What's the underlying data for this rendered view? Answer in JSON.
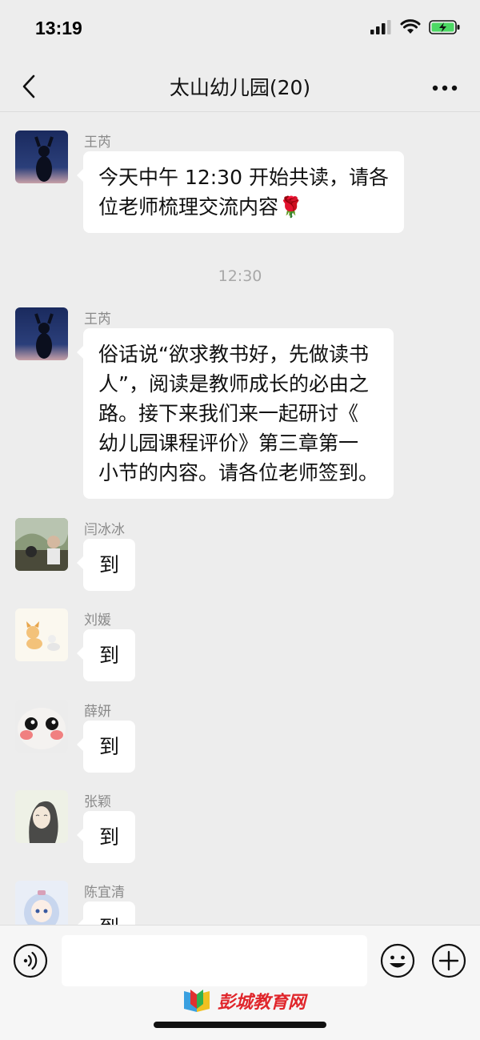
{
  "status": {
    "time": "13:19"
  },
  "header": {
    "title": "太山幼儿园(20)"
  },
  "messages": [
    {
      "sender": "王芮",
      "lines": [
        "今天中午 12:30 开始共读，请各",
        "位老师梳理交流内容🌹"
      ]
    },
    {
      "sender": "王芮",
      "lines": [
        "俗话说“欲求教书好，先做读书",
        "人”，阅读是教师成长的必由之",
        "路。接下来我们来一起研讨《",
        "幼儿园课程评价》第三章第一",
        "小节的内容。请各位老师签到。"
      ]
    },
    {
      "sender": "闫冰冰",
      "text": "到"
    },
    {
      "sender": "刘媛",
      "text": "到"
    },
    {
      "sender": "薛妍",
      "text": "到"
    },
    {
      "sender": "张颖",
      "text": "到"
    },
    {
      "sender": "陈宜清",
      "text": "到"
    }
  ],
  "time_divider": "12:30",
  "watermark": {
    "text": "彭城教育网"
  },
  "icons": {
    "back": "chevron-left-icon",
    "more": "more-dots-icon",
    "voice": "voice-icon",
    "emoji": "emoji-icon",
    "plus": "plus-icon",
    "signal": "signal-icon",
    "wifi": "wifi-icon",
    "battery": "battery-charging-icon"
  },
  "colors": {
    "background": "#ededed",
    "bubble": "#ffffff",
    "sender_name": "#8a8a8a",
    "battery_fill": "#4cd964",
    "watermark": "#e0262b"
  }
}
